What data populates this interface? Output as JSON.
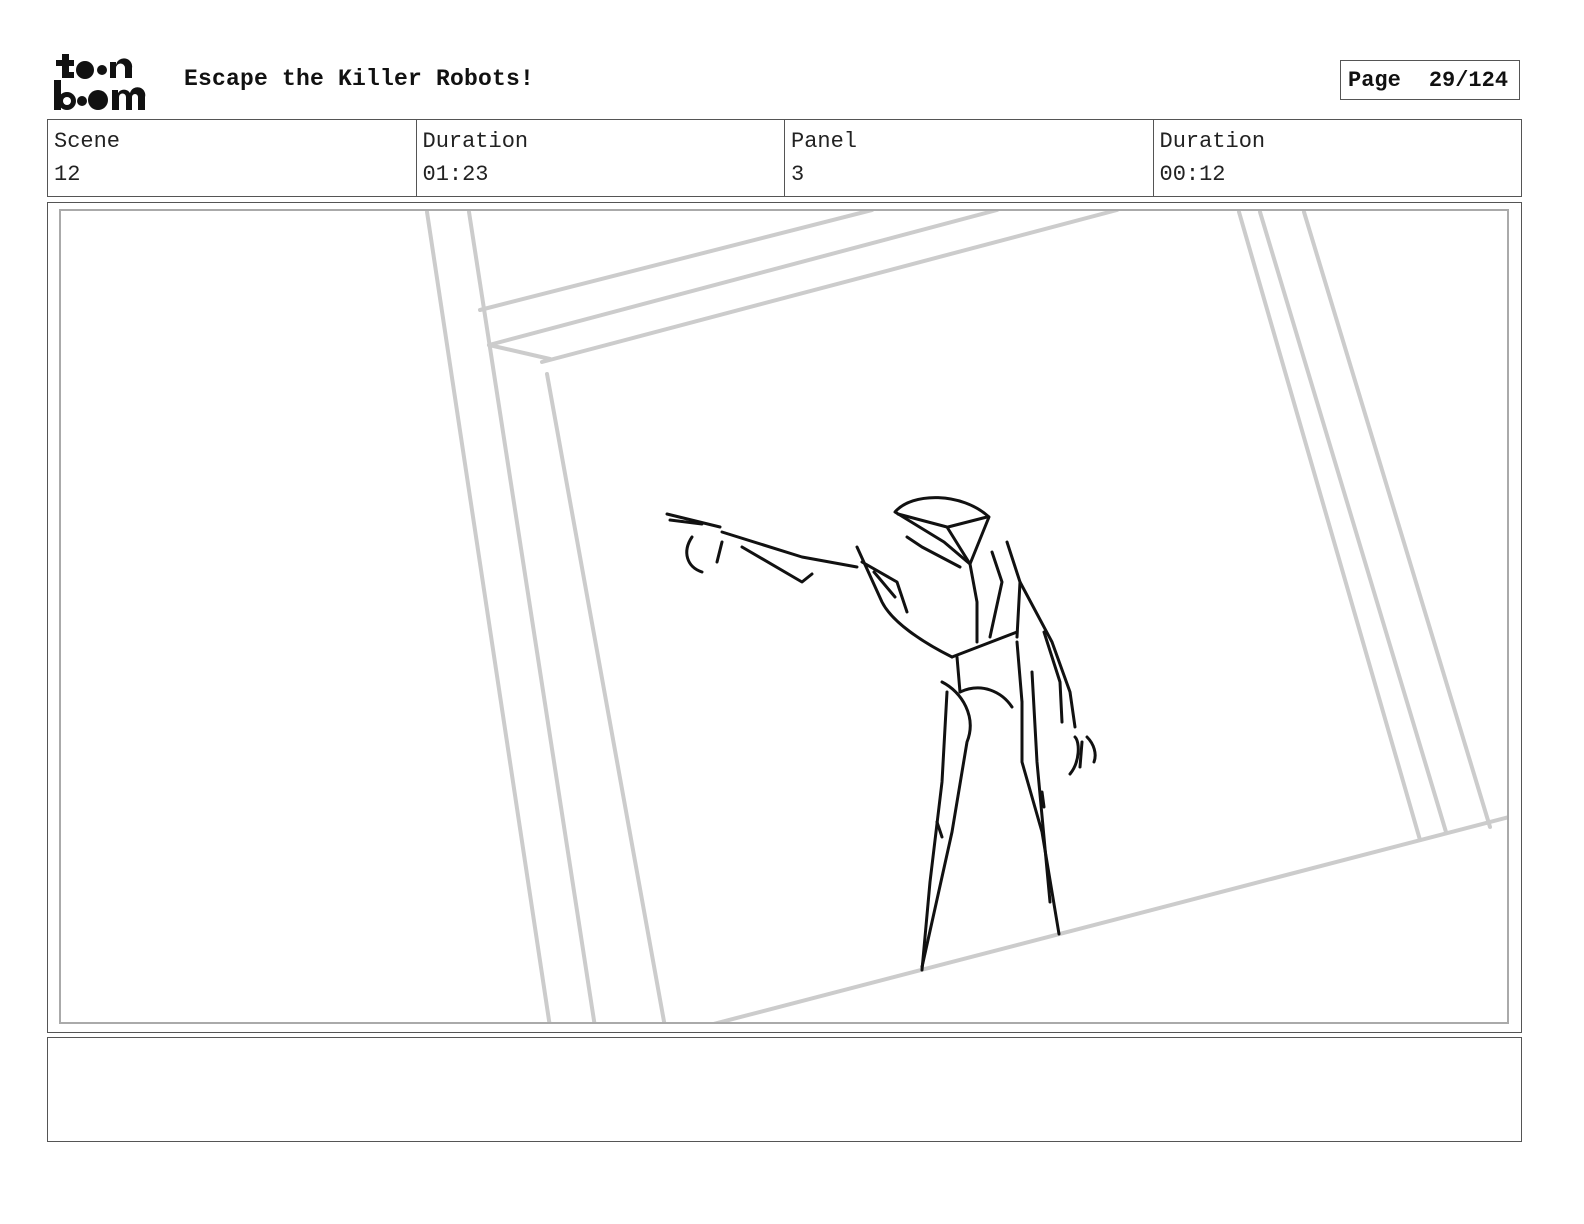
{
  "header": {
    "logo_top": "toon",
    "logo_bottom": "boom",
    "project_title": "Escape the Killer Robots!",
    "page_label": "Page",
    "page_number": "29/124"
  },
  "info": {
    "scene_label": "Scene",
    "scene_value": "12",
    "scene_duration_label": "Duration",
    "scene_duration_value": "01:23",
    "panel_label": "Panel",
    "panel_value": "3",
    "panel_duration_label": "Duration",
    "panel_duration_value": "00:12"
  },
  "notes": {
    "text": ""
  },
  "colors": {
    "ink": "#111111",
    "sketch_gray": "#cccccc",
    "frame_border": "#555555"
  }
}
